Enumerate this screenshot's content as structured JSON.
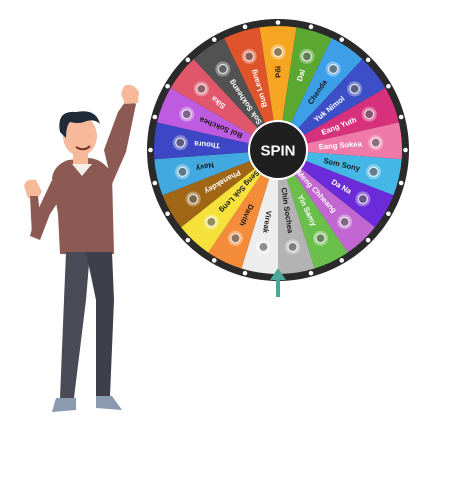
{
  "wheel": {
    "spin_label": "SPIN",
    "segments": [
      {
        "name": "Pối",
        "color": "#F6A623",
        "text_color": "#1a1a1a"
      },
      {
        "name": "Dal",
        "color": "#5AA832",
        "text_color": "#ffffff"
      },
      {
        "name": "Chenda",
        "color": "#3D9FE8",
        "text_color": "#1a1a1a"
      },
      {
        "name": "Yuk Nimol",
        "color": "#3D4FC7",
        "text_color": "#ffffff"
      },
      {
        "name": "Eang Yuth",
        "color": "#D7317E",
        "text_color": "#ffffff"
      },
      {
        "name": "Eang Sokea",
        "color": "#F07AA7",
        "text_color": "#ffffff"
      },
      {
        "name": "Som Sony",
        "color": "#45B7E6",
        "text_color": "#1a1a1a"
      },
      {
        "name": "Da Na",
        "color": "#6C2BD9",
        "text_color": "#ffffff"
      },
      {
        "name": "Meng Chheang",
        "color": "#C266D1",
        "text_color": "#ffffff"
      },
      {
        "name": "Yin Samy",
        "color": "#6ABF4B",
        "text_color": "#ffffff"
      },
      {
        "name": "Chin Sochea",
        "color": "#B3B3B3",
        "text_color": "#1a1a1a"
      },
      {
        "name": "Vireak",
        "color": "#EDEDED",
        "text_color": "#1a1a1a"
      },
      {
        "name": "Davith",
        "color": "#F58C3A",
        "text_color": "#1a1a1a"
      },
      {
        "name": "Seng Sok Leng",
        "color": "#F5E13A",
        "text_color": "#1a1a1a"
      },
      {
        "name": "Phanakdey",
        "color": "#A06615",
        "text_color": "#ffffff"
      },
      {
        "name": "Navy",
        "color": "#41A8E0",
        "text_color": "#1a1a1a"
      },
      {
        "name": "Thoura",
        "color": "#3D46C4",
        "text_color": "#ffffff"
      },
      {
        "name": "Bol Sokchea",
        "color": "#BF5BE0",
        "text_color": "#1a1a1a"
      },
      {
        "name": "Sika",
        "color": "#E0566A",
        "text_color": "#ffffff"
      },
      {
        "name": "Sok Sokheang",
        "color": "#525252",
        "text_color": "#ffffff"
      },
      {
        "name": "Bun Leang",
        "color": "#E0542C",
        "text_color": "#ffffff"
      }
    ]
  },
  "colors": {
    "rim": "#2A2A2A",
    "rim_dots": "#FFFFFF",
    "hub": "#1F1F1F",
    "pointer": "#4BA79A",
    "shirt": "#8C5A53",
    "pants": "#4A4B57",
    "skin": "#F6B99A",
    "hair": "#1E2A38"
  }
}
